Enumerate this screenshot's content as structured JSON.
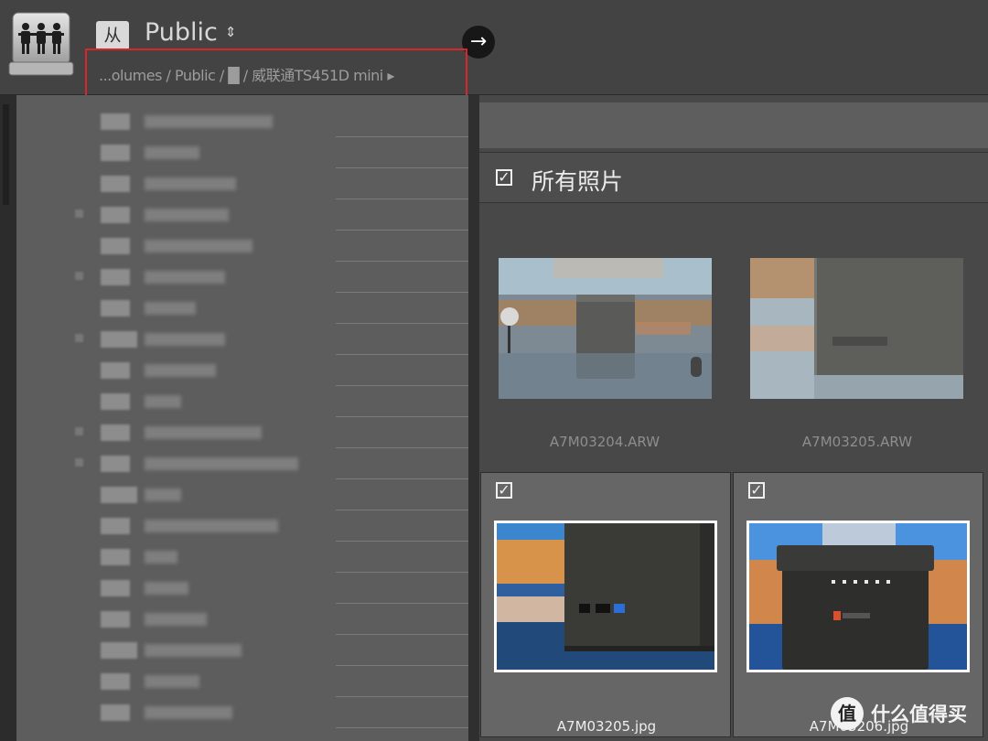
{
  "header": {
    "source_badge": "从",
    "source_title": "Public",
    "source_caret": "⇕",
    "go_arrow": "→",
    "path": "...olumes / Public / █    / 威联通TS451D mini ▸",
    "icons": [
      "shared-drive-icon",
      "arrow-right-icon"
    ]
  },
  "grid": {
    "all_label": "所有照片",
    "all_checked": "✓",
    "tiles": [
      {
        "filename": "A7M03204.ARW",
        "selected": false
      },
      {
        "filename": "A7M03205.ARW",
        "selected": false
      },
      {
        "filename": "A7M03205.jpg",
        "selected": true,
        "check": "✓"
      },
      {
        "filename": "A7M03206.jpg",
        "selected": true,
        "check": "✓"
      }
    ]
  },
  "watermark": {
    "badge": "值",
    "text": "什么值得买"
  },
  "colors": {
    "highlight_box": "#d9262c",
    "panel_bg": "#5d5d5d",
    "header_bg": "#434343"
  }
}
